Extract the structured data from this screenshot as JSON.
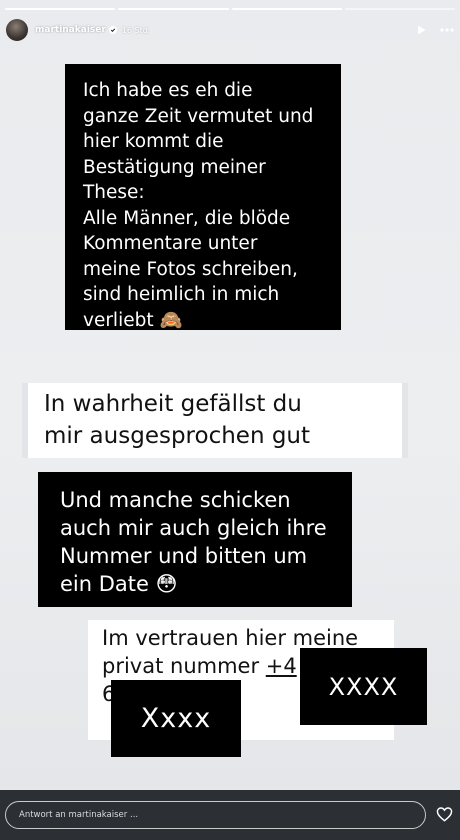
{
  "story": {
    "progress_segments": [
      true,
      true,
      true,
      false
    ],
    "username": "martinakaiser",
    "time": "16 Std.",
    "icons": [
      "avatar",
      "verified-icon",
      "play-icon",
      "more-icon"
    ]
  },
  "text_blocks": {
    "block1_lines": [
      "Ich habe es eh die",
      "ganze Zeit vermutet und",
      "hier kommt die",
      "Bestätigung meiner",
      "These:",
      "Alle Männer, die blöde",
      "Kommentare unter",
      "meine Fotos schreiben,",
      "sind heimlich in mich",
      "verliebt 🙈"
    ],
    "block2_lines": [
      "In wahrheit gefällst du",
      "mir ausgesprochen gut"
    ],
    "block3_lines": [
      "Und manche schicken",
      "auch mir auch gleich ihre",
      "Nummer und bitten um",
      "ein Date 😳"
    ],
    "block4_line1": "Im vertrauen hier meine",
    "block4_line2_text": "privat nummer ",
    "block4_line2_number": "+4",
    "block4_line3": "6"
  },
  "redactions": {
    "right": "XXXX",
    "left": "Xxxx"
  },
  "footer": {
    "reply_placeholder": "Antwort an martinakaiser ...",
    "icons": [
      "heart-icon"
    ]
  }
}
